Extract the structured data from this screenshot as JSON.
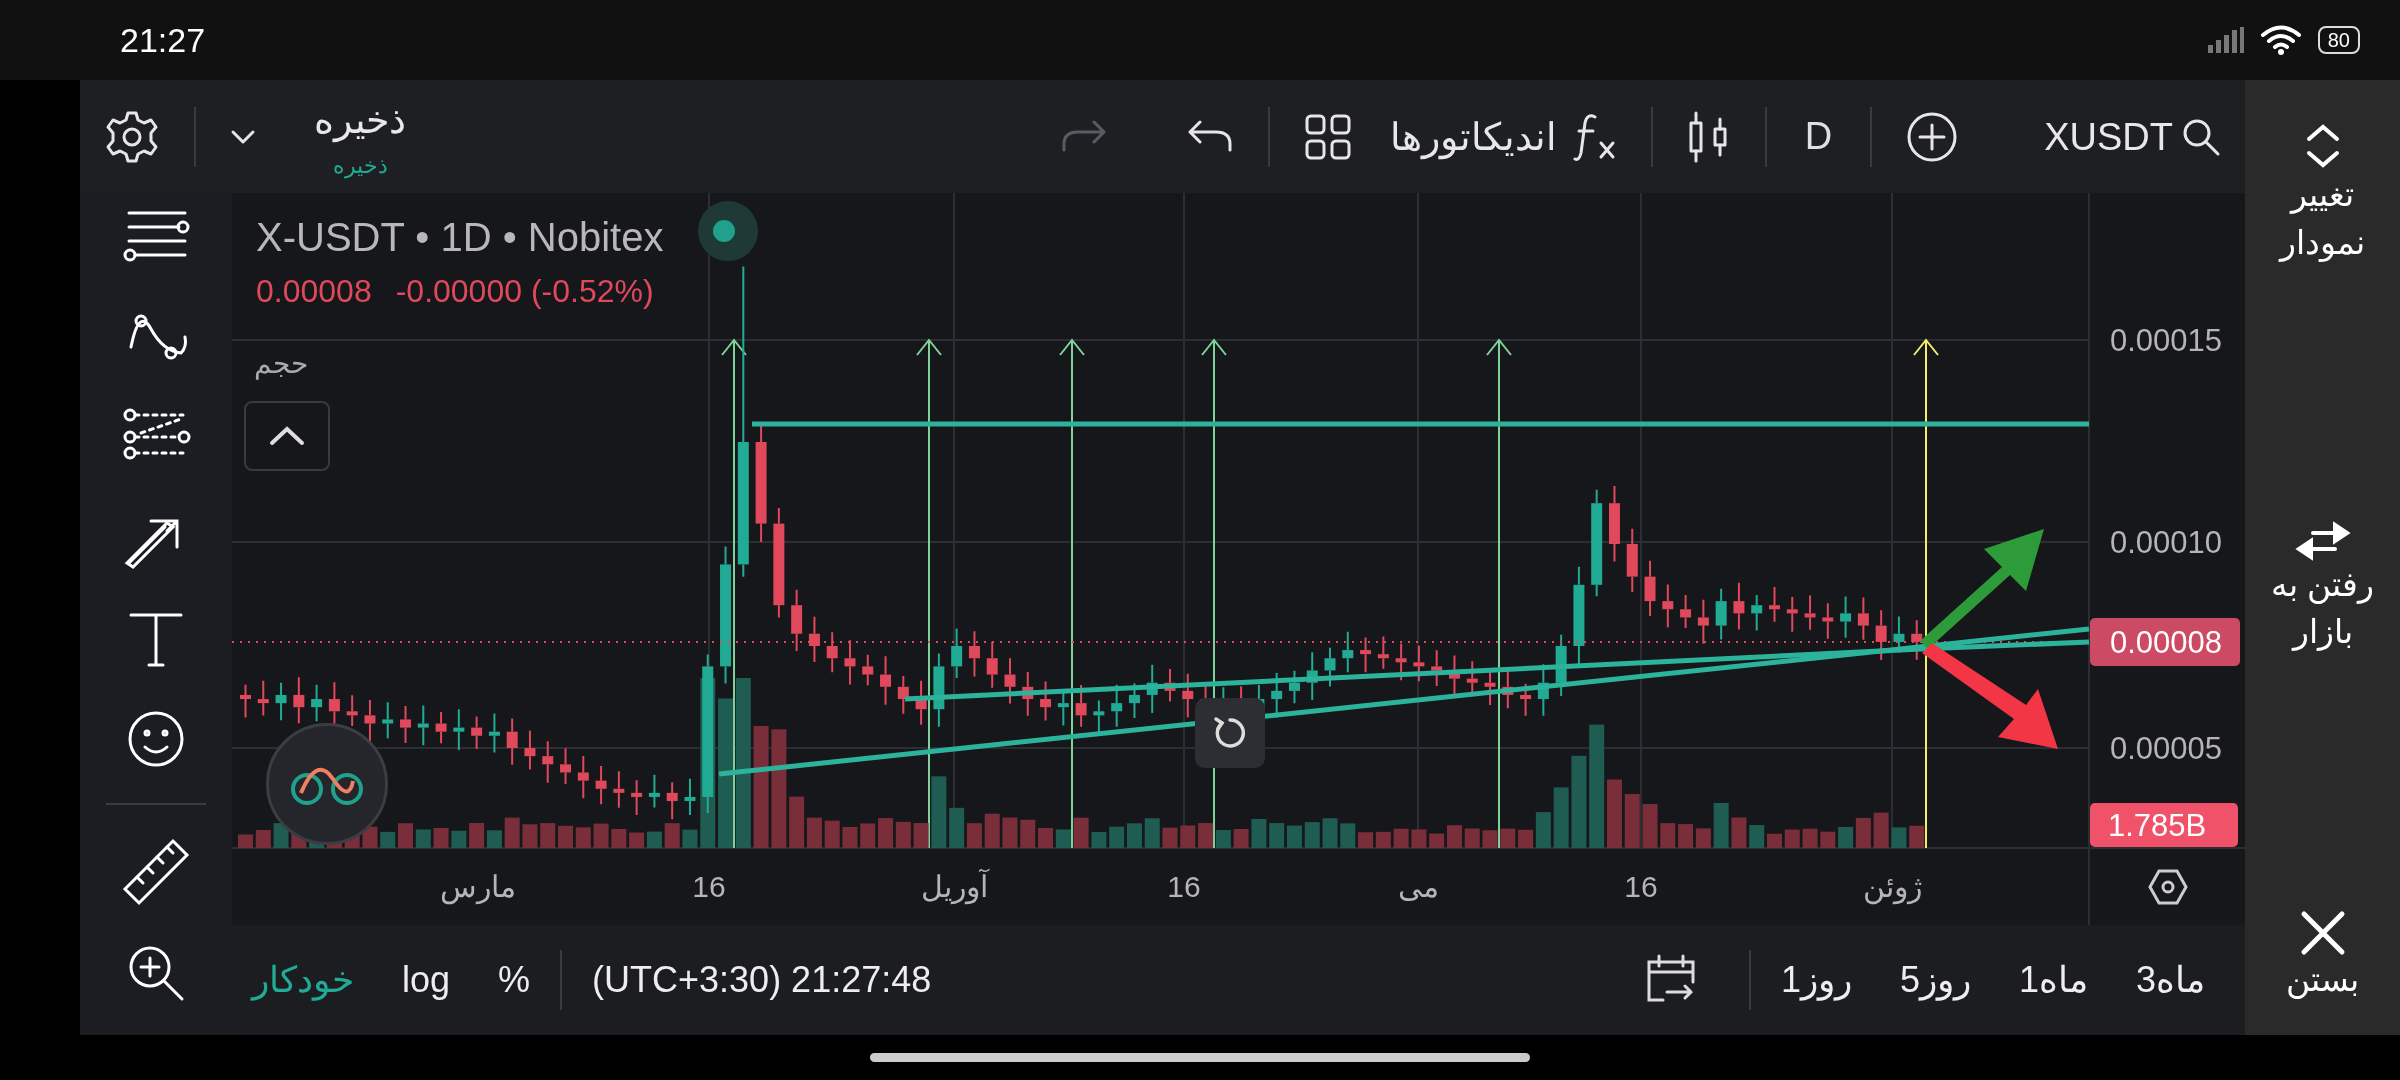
{
  "status_bar": {
    "time": "21:27",
    "battery": "80"
  },
  "toolbar": {
    "save": {
      "label": "ذخیره",
      "sublabel": "ذخیره"
    },
    "history": [
      {
        "kind": "redo",
        "disabled": true
      },
      {
        "kind": "undo",
        "disabled": false
      }
    ],
    "indicators_label": "اندیکاتورها",
    "interval": "D",
    "symbol": "XUSDT"
  },
  "legend": {
    "title": "X-USDT • 1D • Nobitex",
    "price": "0.00008",
    "change": "-0.00000 (-0.52%)",
    "volume_label": "حجم"
  },
  "price_axis": {
    "labels": [
      "0.00015",
      "0.00010",
      "0.00005"
    ],
    "last_price": "0.00008",
    "volume_tag": "1.785B"
  },
  "time_axis": {
    "labels": [
      "ژوئن",
      "16",
      "می",
      "16",
      "آوریل",
      "16",
      "مارس"
    ]
  },
  "bottom_bar": {
    "scale_modes": [
      {
        "label": "%",
        "selected": false
      },
      {
        "label": "log",
        "selected": false
      },
      {
        "label": "خودکار",
        "selected": true
      }
    ],
    "timezone": "(UTC+3:30) 21:27:48",
    "ranges": [
      "3ماه",
      "1ماه",
      "5روز",
      "1روز"
    ]
  },
  "side_panel": [
    {
      "kind": "change_chart",
      "label": "تغییر نمودار"
    },
    {
      "kind": "go_market",
      "label": "رفتن به بازار"
    },
    {
      "kind": "close",
      "label": "بستن"
    }
  ]
}
